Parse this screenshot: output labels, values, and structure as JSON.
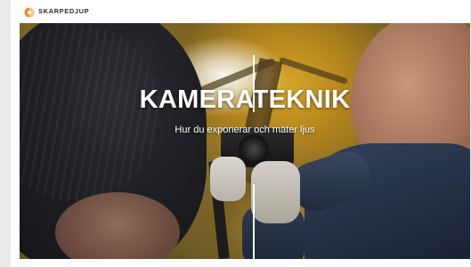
{
  "brand": {
    "name": "SKARPEDJUP"
  },
  "hero": {
    "title": "KAMERATEKNIK",
    "subtitle": "Hur du exponerar och mäter ljus"
  },
  "colors": {
    "logo_orange": "#f08a24",
    "page_bg": "#ebebeb",
    "text_white": "#ffffff"
  },
  "icons": {
    "logo": "skarpedjup-logo-icon"
  }
}
